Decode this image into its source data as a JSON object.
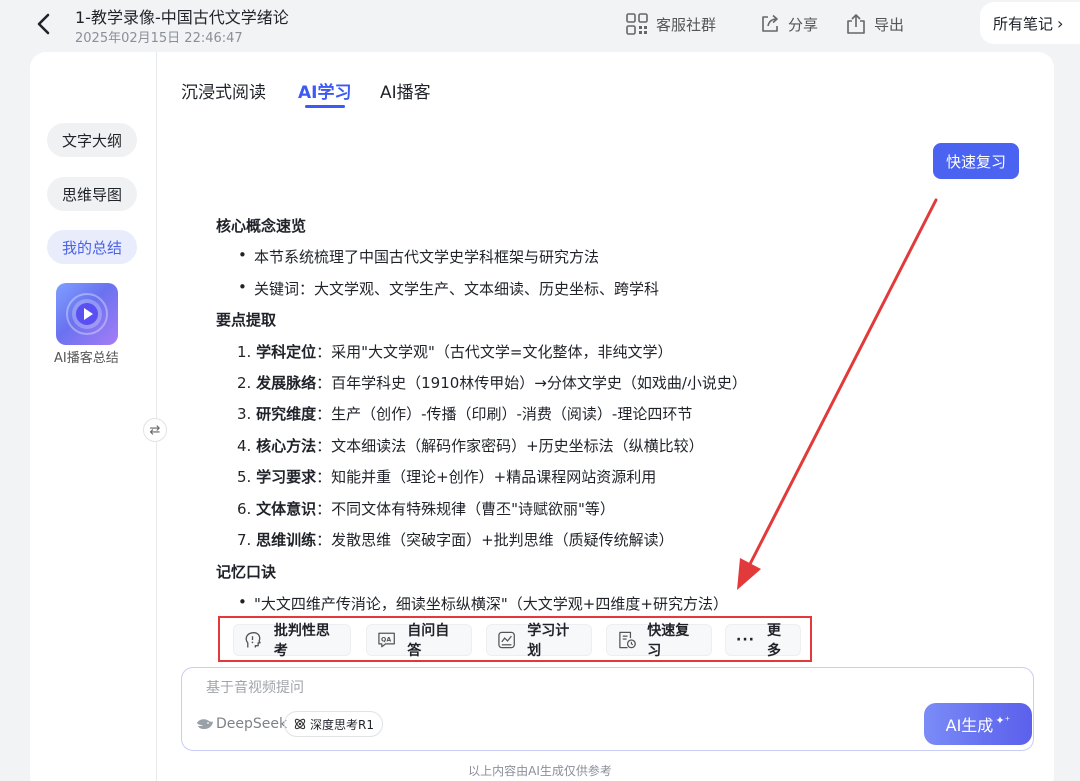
{
  "header": {
    "title": "1-教学录像-中国古代文学绪论",
    "timestamp": "2025年02月15日 22:46:47",
    "customer_group": "客服社群",
    "share": "分享",
    "export": "导出",
    "all_notes": "所有笔记"
  },
  "sidebar": {
    "items": [
      {
        "label": "文字大纲"
      },
      {
        "label": "思维导图"
      },
      {
        "label": "我的总结"
      }
    ],
    "podcast_label": "AI播客总结"
  },
  "tabs": [
    {
      "label": "沉浸式阅读"
    },
    {
      "label": "AI学习"
    },
    {
      "label": "AI播客"
    }
  ],
  "quick_review_button": "快速复习",
  "summary": {
    "core_title": "核心概念速览",
    "core_bullets": [
      "本节系统梳理了中国古代文学史学科框架与研究方法",
      "关键词：大文学观、文学生产、文本细读、历史坐标、跨学科"
    ],
    "points_title": "要点提取",
    "points": [
      {
        "num": "1.",
        "term": "学科定位",
        "text": "：采用\"大文学观\"（古代文学=文化整体，非纯文学）"
      },
      {
        "num": "2.",
        "term": "发展脉络",
        "text": "：百年学科史（1910林传甲始）→分体文学史（如戏曲/小说史）"
      },
      {
        "num": "3.",
        "term": "研究维度",
        "text": "：生产（创作）-传播（印刷）-消费（阅读）-理论四环节"
      },
      {
        "num": "4.",
        "term": "核心方法",
        "text": "：文本细读法（解码作家密码）+历史坐标法（纵横比较）"
      },
      {
        "num": "5.",
        "term": "学习要求",
        "text": "：知能并重（理论+创作）+精品课程网站资源利用"
      },
      {
        "num": "6.",
        "term": "文体意识",
        "text": "：不同文体有特殊规律（曹丕\"诗赋欲丽\"等）"
      },
      {
        "num": "7.",
        "term": "思维训练",
        "text": "：发散思维（突破字面）+批判思维（质疑传统解读）"
      }
    ],
    "mnemonic_title": "记忆口诀",
    "mnemonic_bullets": [
      "\"大文四维产传消论，细读坐标纵横深\"（大文学观+四维度+研究方法）"
    ]
  },
  "actions": {
    "critical": "批判性思考",
    "qa": "自问自答",
    "plan": "学习计划",
    "review": "快速复习",
    "more": "更多"
  },
  "ask": {
    "placeholder": "基于音视频提问",
    "model": "DeepSeek",
    "deep_think": "深度思考R1",
    "generate": "AI生成"
  },
  "footer_note": "以上内容由AI生成仅供参考",
  "colors": {
    "accent": "#3d5af1",
    "annotation_red": "#e23a3a"
  }
}
